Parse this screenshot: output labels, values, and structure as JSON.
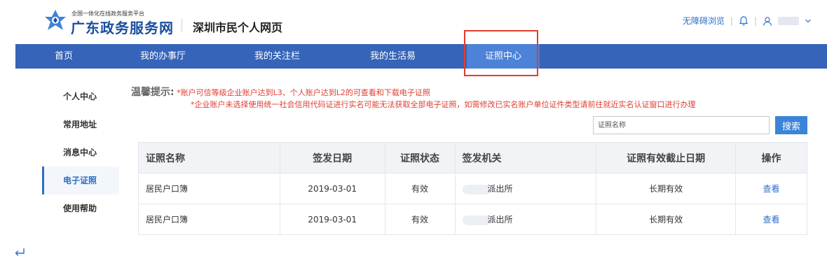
{
  "header": {
    "logo_small": "全国一体化在线政务服务平台",
    "logo_big": "广东政务服务网",
    "city_title": "深圳市民个人网页",
    "accessibility_link": "无障碍浏览",
    "bell_icon": "bell-icon",
    "user_icon": "user-icon",
    "dropdown_icon": "chevron-down-icon"
  },
  "nav": {
    "items": [
      {
        "label": "首页"
      },
      {
        "label": "我的办事厅"
      },
      {
        "label": "我的关注栏"
      },
      {
        "label": "我的生活易"
      },
      {
        "label": "证照中心"
      }
    ],
    "active": "证照中心"
  },
  "sidebar": {
    "items": [
      {
        "label": "个人中心"
      },
      {
        "label": "常用地址"
      },
      {
        "label": "消息中心"
      },
      {
        "label": "电子证照"
      },
      {
        "label": "使用帮助"
      }
    ],
    "active": "电子证照"
  },
  "tips": {
    "title": "温馨提示:",
    "line1": "*账户可信等级企业账户达到L3、个人账户达到L2的可查看和下载电子证照",
    "line2": "*企业账户未选择使用统一社会信用代码证进行实名可能无法获取全部电子证照，如需修改已实名账户单位证件类型请前往就近实名认证窗口进行办理"
  },
  "search": {
    "placeholder": "证照名称",
    "button": "搜索"
  },
  "table": {
    "columns": [
      "证照名称",
      "签发日期",
      "证照状态",
      "签发机关",
      "证照有效截止日期",
      "操作"
    ],
    "rows": [
      [
        "居民户口簿",
        "2019-03-01",
        "有效",
        "派出所",
        "长期有效",
        "查看"
      ],
      [
        "居民户口簿",
        "2019-03-01",
        "有效",
        "派出所",
        "长期有效",
        "查看"
      ]
    ]
  },
  "colors": {
    "nav_bg": "#3564b8",
    "nav_active": "#4c82d8",
    "accent": "#2d6ec8",
    "warning_red": "#e03c31",
    "highlight_box": "#e03c31"
  }
}
